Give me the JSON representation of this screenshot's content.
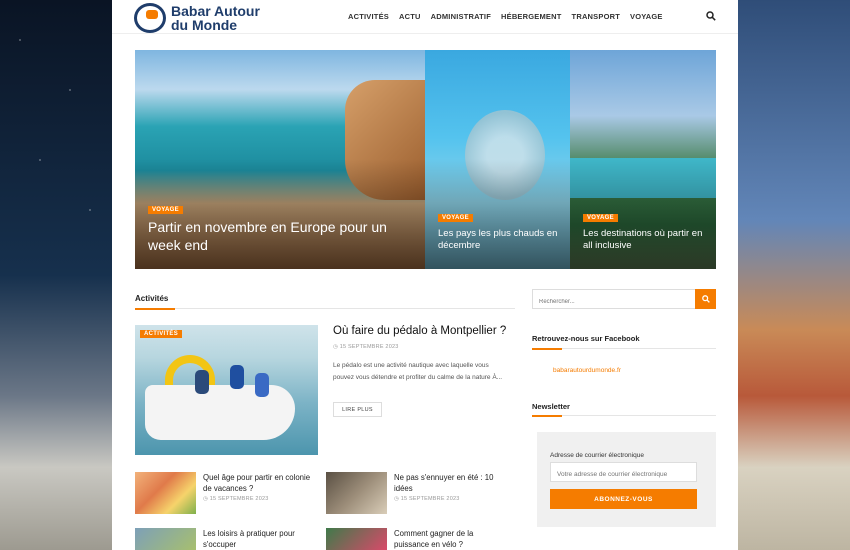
{
  "logo": {
    "line1": "Babar Autour",
    "line2": "du Monde"
  },
  "nav": [
    "ACTIVITÉS",
    "ACTU",
    "ADMINISTRATIF",
    "HÉBERGEMENT",
    "TRANSPORT",
    "VOYAGE"
  ],
  "hero": [
    {
      "category": "VOYAGE",
      "title": "Partir en novembre en Europe pour un week end"
    },
    {
      "category": "VOYAGE",
      "title": "Les pays les plus chauds en décembre"
    },
    {
      "category": "VOYAGE",
      "title": "Les destinations où partir en all inclusive"
    }
  ],
  "section": {
    "title": "Activités"
  },
  "featured": {
    "category": "ACTIVITÉS",
    "title": "Où faire du pédalo à Montpellier ?",
    "date": "15 SEPTEMBRE 2023",
    "excerpt": "Le pédalo est une activité nautique avec laquelle vous pouvez vous détendre et profiter du calme de la nature À...",
    "read_more": "LIRE PLUS"
  },
  "cards": [
    {
      "title": "Quel âge pour partir en colonie de vacances ?",
      "date": "15 SEPTEMBRE 2023"
    },
    {
      "title": "Ne pas s'ennuyer en été : 10 idées",
      "date": "15 SEPTEMBRE 2023"
    },
    {
      "title": "Les loisirs à pratiquer pour s'occuper",
      "date": ""
    },
    {
      "title": "Comment gagner de la puissance en vélo ?",
      "date": ""
    }
  ],
  "sidebar": {
    "search_placeholder": "Rechercher...",
    "facebook_title": "Retrouvez-nous sur Facebook",
    "facebook_link": "babarautourdumonde.fr",
    "newsletter_title": "Newsletter",
    "newsletter_label": "Adresse de courrier électronique",
    "newsletter_placeholder": "Votre adresse de courrier électronique",
    "newsletter_button": "ABONNEZ-VOUS"
  },
  "colors": {
    "accent": "#f57c00",
    "brand": "#1f3d6b"
  }
}
